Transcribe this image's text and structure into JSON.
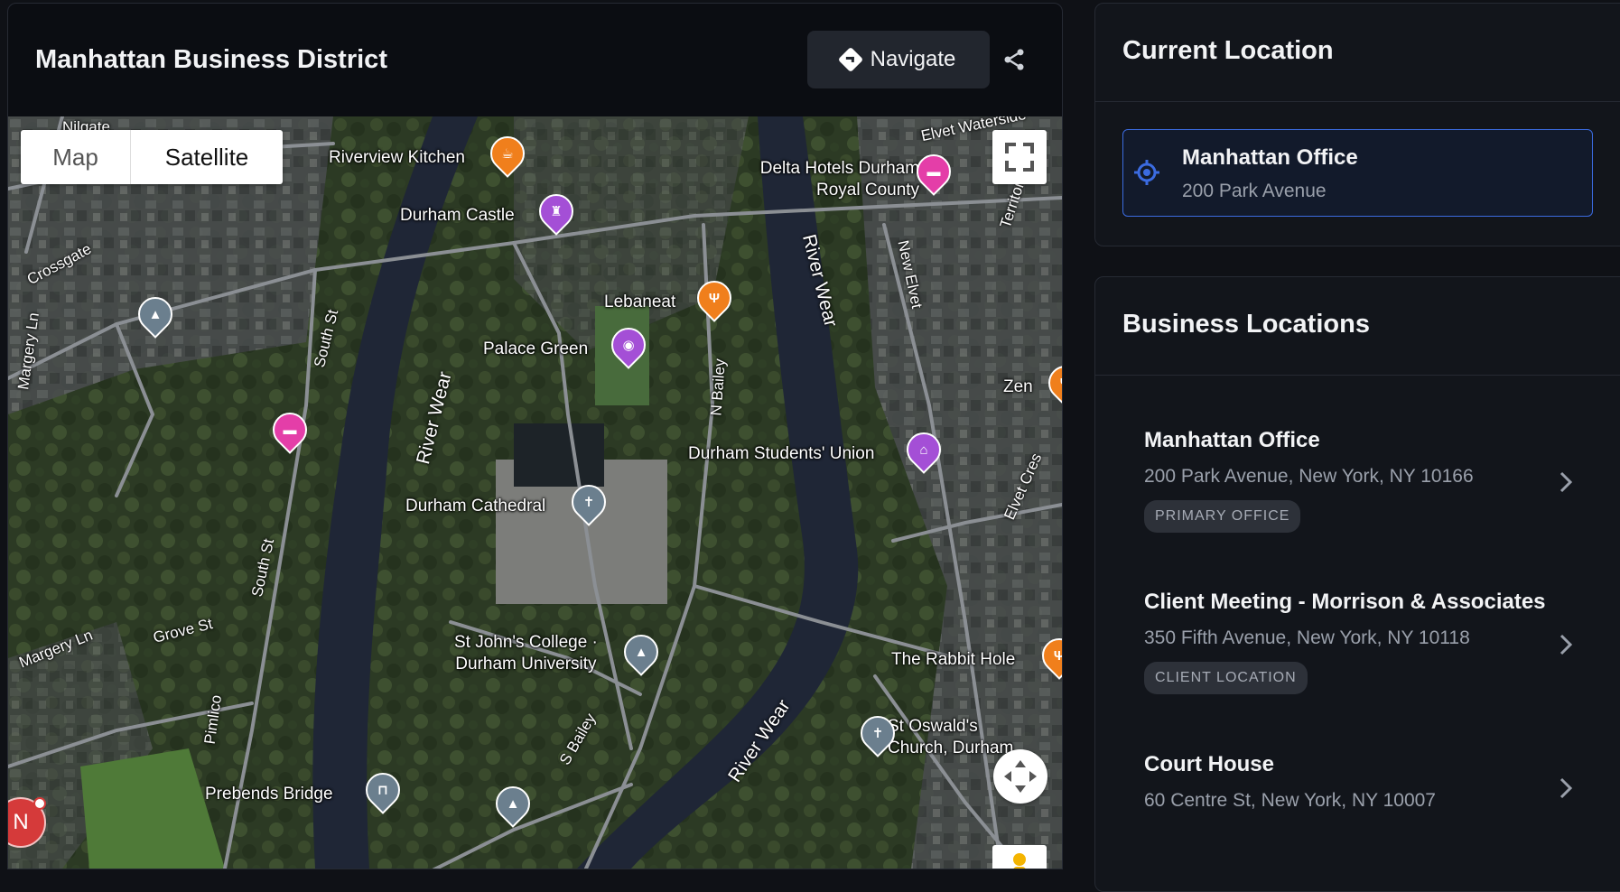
{
  "map": {
    "title": "Manhattan Business District",
    "navigate_label": "Navigate",
    "toggle": {
      "map": "Map",
      "satellite": "Satellite",
      "selected": "Satellite"
    },
    "compass_label": "N",
    "pois": [
      {
        "name": "Riverview Kitchen",
        "category": "cafe",
        "color": "#f07f1c"
      },
      {
        "name": "Durham Castle",
        "category": "castle",
        "color": "#a44fd6"
      },
      {
        "name": "Delta Hotels Durham",
        "line2": "Royal County",
        "category": "hotel",
        "color": "#e43ea8"
      },
      {
        "name": "Lebaneat",
        "category": "restaurant",
        "color": "#f07f1c"
      },
      {
        "name": "Palace Green",
        "category": "camera",
        "color": "#a44fd6"
      },
      {
        "name": "Zen",
        "category": "restaurant",
        "color": "#f07f1c"
      },
      {
        "name": "Durham Students' Union",
        "category": "landmark",
        "color": "#a44fd6"
      },
      {
        "name": "Durham Cathedral",
        "category": "church",
        "color": "#6b7f8e"
      },
      {
        "name": "St John's College ·",
        "line2": "Durham University",
        "category": "school",
        "color": "#6b7f8e"
      },
      {
        "name": "The Rabbit Hole",
        "category": "restaurant",
        "color": "#f07f1c"
      },
      {
        "name": "St Oswald's",
        "line2": "Church, Durham",
        "category": "church",
        "color": "#6b7f8e"
      },
      {
        "name": "Prebends Bridge",
        "category": "bridge",
        "color": "#6b7f8e"
      }
    ],
    "roads": [
      "Crossgate",
      "Margery Ln",
      "South St",
      "River Wear",
      "N Bailey",
      "New Elvet",
      "Elvet Waterside",
      "Territorial",
      "Elvet Cres",
      "Grove St",
      "Pimlico",
      "S Bailey",
      "Nilgate"
    ]
  },
  "current_location": {
    "title": "Current Location",
    "name": "Manhattan Office",
    "address": "200 Park Avenue"
  },
  "business_locations": {
    "title": "Business Locations",
    "items": [
      {
        "name": "Manhattan Office",
        "address": "200 Park Avenue, New York, NY 10166",
        "badge": "PRIMARY OFFICE"
      },
      {
        "name": "Client Meeting - Morrison & Associates",
        "address": "350 Fifth Avenue, New York, NY 10118",
        "badge": "CLIENT LOCATION"
      },
      {
        "name": "Court House",
        "address": "60 Centre St, New York, NY 10007",
        "badge": ""
      }
    ]
  },
  "colors": {
    "accent": "#3b6be0",
    "page_bg": "#0f1116",
    "panel_bg": "#12151b"
  }
}
